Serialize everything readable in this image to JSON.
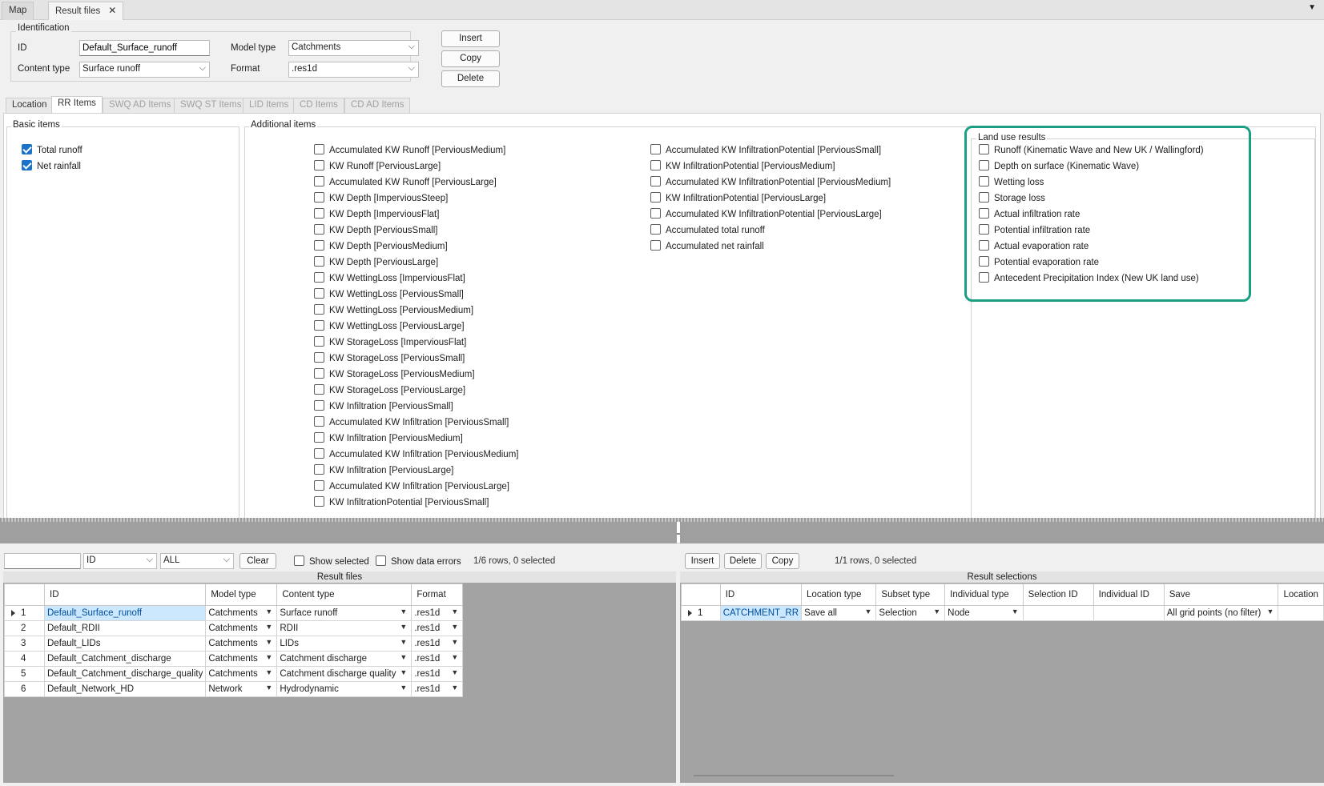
{
  "tabs": [
    {
      "label": "Map"
    },
    {
      "label": "Result files"
    }
  ],
  "identification": {
    "title": "Identification",
    "id_label": "ID",
    "id_value": "Default_Surface_runoff",
    "content_type_label": "Content type",
    "content_type_value": "Surface runoff",
    "model_type_label": "Model type",
    "model_type_value": "Catchments",
    "format_label": "Format",
    "format_value": ".res1d",
    "insert": "Insert",
    "copy": "Copy",
    "delete": "Delete"
  },
  "inner_tabs": [
    "Location",
    "RR Items",
    "SWQ AD Items",
    "SWQ ST Items",
    "LID Items",
    "CD Items",
    "CD AD Items"
  ],
  "basic_items": {
    "title": "Basic items",
    "items": [
      {
        "label": "Total runoff",
        "checked": true
      },
      {
        "label": "Net rainfall",
        "checked": true
      }
    ]
  },
  "additional_items": {
    "title": "Additional items",
    "col1": [
      "Accumulated KW Runoff [PerviousMedium]",
      "KW Runoff [PerviousLarge]",
      "Accumulated KW Runoff [PerviousLarge]",
      "KW Depth [ImperviousSteep]",
      "KW Depth [ImperviousFlat]",
      "KW Depth [PerviousSmall]",
      "KW Depth [PerviousMedium]",
      "KW Depth [PerviousLarge]",
      "KW WettingLoss [ImperviousFlat]",
      "KW WettingLoss [PerviousSmall]",
      "KW WettingLoss [PerviousMedium]",
      "KW WettingLoss [PerviousLarge]",
      "KW StorageLoss [ImperviousFlat]",
      "KW StorageLoss [PerviousSmall]",
      "KW StorageLoss [PerviousMedium]",
      "KW StorageLoss [PerviousLarge]",
      "KW Infiltration [PerviousSmall]",
      "Accumulated KW Infiltration [PerviousSmall]",
      "KW Infiltration [PerviousMedium]",
      "Accumulated KW Infiltration [PerviousMedium]",
      "KW Infiltration [PerviousLarge]",
      "Accumulated KW Infiltration [PerviousLarge]",
      "KW InfiltrationPotential [PerviousSmall]"
    ],
    "col2": [
      "Accumulated KW InfiltrationPotential [PerviousSmall]",
      "KW InfiltrationPotential [PerviousMedium]",
      "Accumulated KW InfiltrationPotential [PerviousMedium]",
      "KW InfiltrationPotential [PerviousLarge]",
      "Accumulated KW InfiltrationPotential [PerviousLarge]",
      "Accumulated total runoff",
      "Accumulated net rainfall"
    ]
  },
  "land_use": {
    "title": "Land use results",
    "items": [
      "Runoff (Kinematic Wave and New UK / Wallingford)",
      "Depth on surface (Kinematic Wave)",
      "Wetting loss",
      "Storage loss",
      "Actual infiltration rate",
      "Potential infiltration rate",
      "Actual evaporation rate",
      "Potential evaporation rate",
      "Antecedent Precipitation Index (New UK land use)"
    ],
    "highlight_color": "#1a9e84"
  },
  "left_toolbar": {
    "search_value": "",
    "field_combo": "ID",
    "filter_combo": "ALL",
    "clear": "Clear",
    "show_selected": "Show selected",
    "show_errors": "Show data errors",
    "status": "1/6 rows, 0 selected"
  },
  "result_files": {
    "title": "Result files",
    "columns": [
      "ID",
      "Model type",
      "Content type",
      "Format"
    ],
    "rows": [
      {
        "n": "1",
        "id": "Default_Surface_runoff",
        "model": "Catchments",
        "content": "Surface runoff",
        "format": ".res1d"
      },
      {
        "n": "2",
        "id": "Default_RDII",
        "model": "Catchments",
        "content": "RDII",
        "format": ".res1d"
      },
      {
        "n": "3",
        "id": "Default_LIDs",
        "model": "Catchments",
        "content": "LIDs",
        "format": ".res1d"
      },
      {
        "n": "4",
        "id": "Default_Catchment_discharge",
        "model": "Catchments",
        "content": "Catchment discharge",
        "format": ".res1d"
      },
      {
        "n": "5",
        "id": "Default_Catchment_discharge_quality",
        "model": "Catchments",
        "content": "Catchment discharge quality",
        "format": ".res1d"
      },
      {
        "n": "6",
        "id": "Default_Network_HD",
        "model": "Network",
        "content": "Hydrodynamic",
        "format": ".res1d"
      }
    ]
  },
  "right_toolbar": {
    "insert": "Insert",
    "delete": "Delete",
    "copy": "Copy",
    "status": "1/1 rows, 0 selected"
  },
  "result_selections": {
    "title": "Result selections",
    "columns": [
      "ID",
      "Location type",
      "Subset type",
      "Individual type",
      "Selection ID",
      "Individual ID",
      "Save",
      "Location"
    ],
    "rows": [
      {
        "n": "1",
        "id": "CATCHMENT_RR",
        "location_type": "Save all",
        "subset_type": "Selection",
        "individual_type": "Node",
        "selection_id": "",
        "individual_id": "",
        "save": "All grid points (no filter)",
        "location": ""
      }
    ]
  }
}
